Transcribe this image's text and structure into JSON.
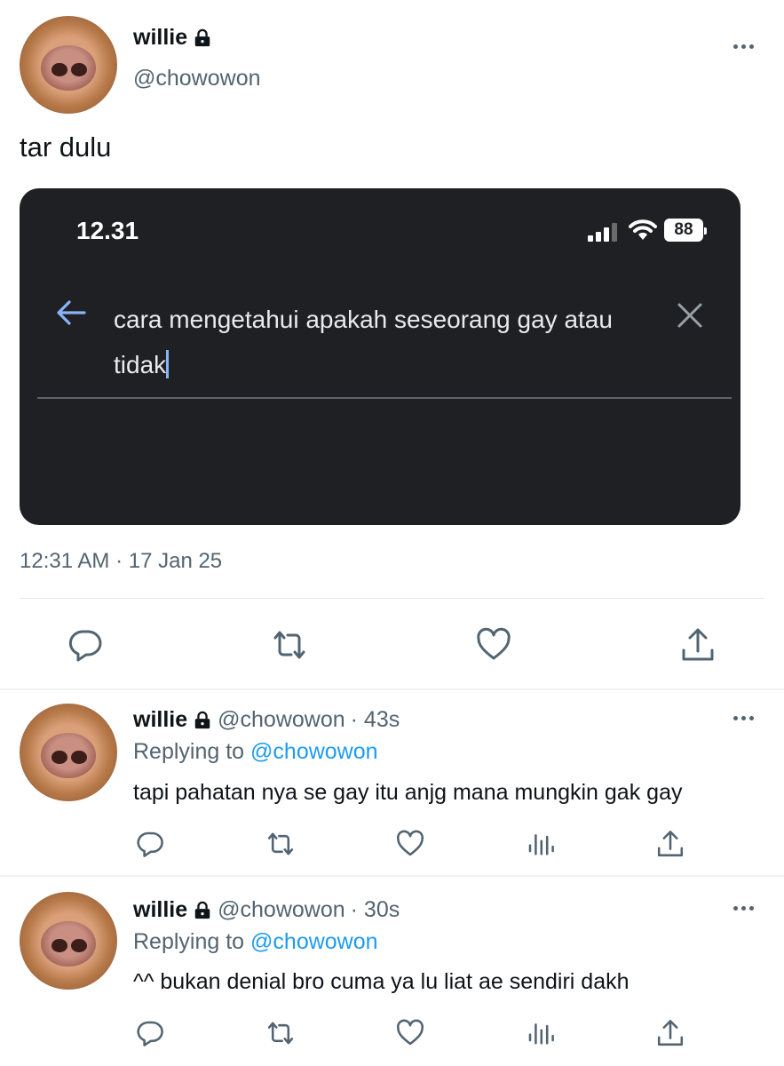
{
  "tweet": {
    "author_name": "willie",
    "author_handle": "@chowowon",
    "text": "tar dulu",
    "timestamp": "12:31 AM · 17 Jan 25",
    "media": {
      "status_time": "12.31",
      "battery": "88",
      "search_query": "cara mengetahui apakah seseorang gay atau tidak"
    },
    "icons": [
      "reply-icon",
      "retweet-icon",
      "like-icon",
      "share-icon"
    ]
  },
  "replies": [
    {
      "author_name": "willie",
      "author_handle": "@chowowon",
      "age": "· 43s",
      "replying_label": "Replying to",
      "replying_to": "@chowowon",
      "text": "tapi pahatan nya se gay itu anjg mana mungkin gak gay"
    },
    {
      "author_name": "willie",
      "author_handle": "@chowowon",
      "age": "· 30s",
      "replying_label": "Replying to",
      "replying_to": "@chowowon",
      "text": "^^ bukan denial bro cuma ya lu liat ae sendiri dakh"
    }
  ],
  "colors": {
    "text": "#0f1419",
    "secondary": "#536471",
    "link": "#1d9bf0",
    "media_bg": "#1f2023"
  }
}
